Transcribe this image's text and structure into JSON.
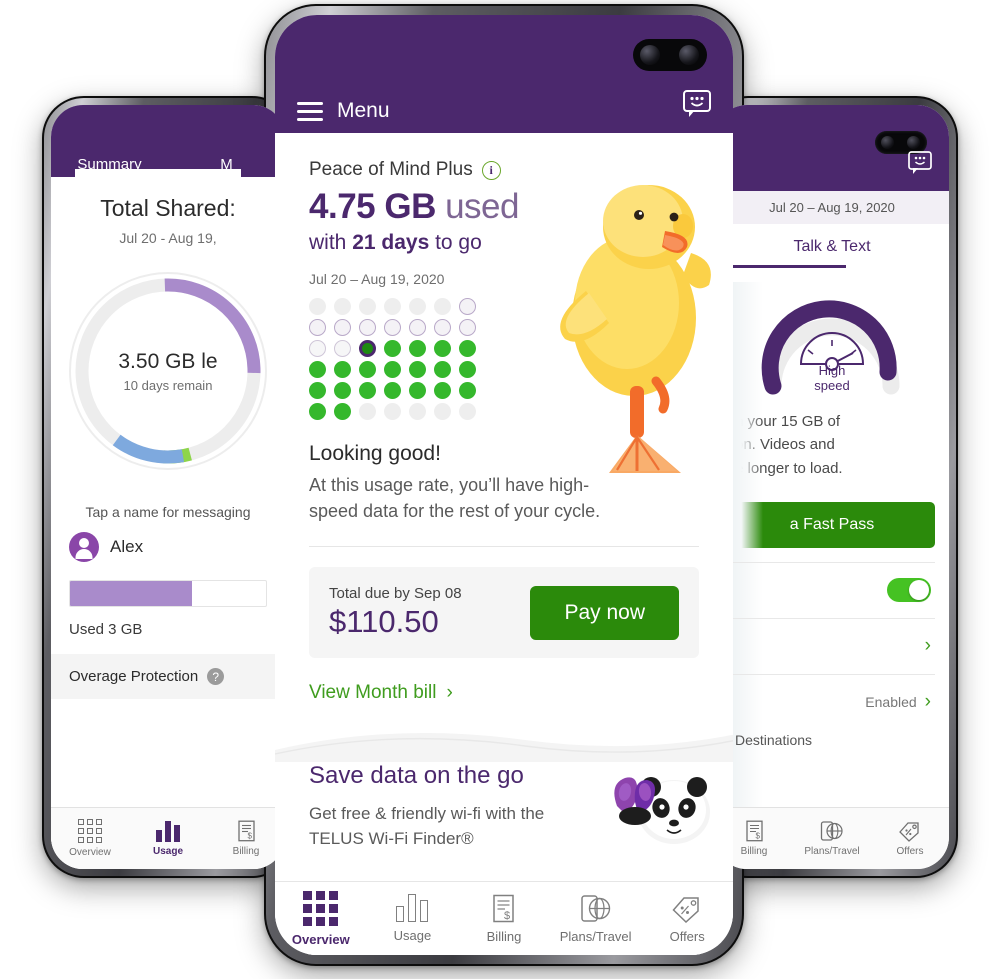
{
  "left_phone": {
    "tabs": [
      {
        "label": "Summary",
        "active": true
      },
      {
        "label": "M",
        "active": false
      }
    ],
    "title": "Total Shared:",
    "date_range": "Jul 20 - Aug 19,",
    "donut": {
      "center_main": "3.50 GB le",
      "center_note": "10 days remain",
      "segments": [
        {
          "name": "used-purple",
          "color": "#A98BCB",
          "percent": 26
        },
        {
          "name": "remaining-track",
          "color": "#ededed",
          "percent": 56
        },
        {
          "name": "green-segment",
          "color": "#8ED54A",
          "percent": 5
        },
        {
          "name": "blue-segment",
          "color": "#7EA9DE",
          "percent": 13
        }
      ]
    },
    "tap_hint": "Tap a name for messaging",
    "person": {
      "name": "Alex",
      "avatar": "person-avatar"
    },
    "usage_bar": {
      "fill_percent": 62,
      "used_label": "Used 3 GB"
    },
    "overage": {
      "label": "Overage Protection",
      "help": "?"
    },
    "tabbar": [
      {
        "label": "Overview",
        "icon": "grid-icon",
        "active": false
      },
      {
        "label": "Usage",
        "icon": "bar-chart-icon",
        "active": true
      },
      {
        "label": "Billing",
        "icon": "receipt-icon",
        "active": false
      }
    ]
  },
  "center_phone": {
    "header": {
      "menu_label": "Menu",
      "menu_icon": "hamburger-icon",
      "chat_icon": "chat-smiley-icon"
    },
    "plan": {
      "name": "Peace of Mind Plus",
      "info_icon": "info-icon"
    },
    "usage": {
      "amount": "4.75 GB",
      "amount_suffix": " used",
      "days_prefix": "with ",
      "days": "21 days",
      "days_suffix": " to go",
      "date_range": "Jul 20 – Aug 19, 2020"
    },
    "status": {
      "headline": "Looking good!",
      "body": "At this usage rate, you’ll have high-speed data for the rest of your cycle."
    },
    "bill": {
      "due_label": "Total due by Sep 08",
      "amount": "$110.50",
      "pay_label": "Pay now",
      "view_label": "View Month bill",
      "view_chevron": "›"
    },
    "promo": {
      "title": "Save data on the go",
      "body": "Get free & friendly wi-fi with the TELUS Wi-Fi Finder®",
      "image": "panda-illustration"
    },
    "hero_image": "duckling-illustration",
    "tabbar": [
      {
        "label": "Overview",
        "icon": "grid-icon",
        "active": true
      },
      {
        "label": "Usage",
        "icon": "bar-chart-icon",
        "active": false
      },
      {
        "label": "Billing",
        "icon": "receipt-icon",
        "active": false
      },
      {
        "label": "Plans/Travel",
        "icon": "phone-globe-icon",
        "active": false
      },
      {
        "label": "Offers",
        "icon": "tags-icon",
        "active": false
      }
    ]
  },
  "right_phone": {
    "chat_icon": "chat-smiley-icon",
    "date_range": "Jul 20 – Aug 19, 2020",
    "tab_label": "Talk & Text",
    "gauge": {
      "label_line1": "High",
      "label_line2": "speed",
      "icon": "speedometer-icon",
      "fill_percent": 88
    },
    "paragraph": "n your 15 GB of\non. Videos and\ne longer to load.",
    "fast_pass_button": "a Fast Pass",
    "rows": [
      {
        "name": "toggle-row",
        "control": "toggle",
        "state": "on"
      },
      {
        "name": "chevron-row",
        "control": "chevron",
        "value": ""
      },
      {
        "name": "enabled-row",
        "control": "chevron",
        "value": "Enabled"
      }
    ],
    "destinations_label": "Destinations",
    "tabbar": [
      {
        "label": "Billing",
        "icon": "receipt-icon",
        "active": false
      },
      {
        "label": "Plans/Travel",
        "icon": "phone-globe-icon",
        "active": false
      },
      {
        "label": "Offers",
        "icon": "tags-icon",
        "active": false
      }
    ]
  },
  "dot_grid": {
    "rows": [
      [
        "empty",
        "empty",
        "empty",
        "empty",
        "empty",
        "empty",
        "ring"
      ],
      [
        "ring",
        "ring",
        "ring",
        "ring",
        "ring",
        "ring",
        "ring"
      ],
      [
        "ringlt",
        "ringlt",
        "cur",
        "green",
        "green",
        "green",
        "green"
      ],
      [
        "green",
        "green",
        "green",
        "green",
        "green",
        "green",
        "green"
      ],
      [
        "green",
        "green",
        "green",
        "green",
        "green",
        "green",
        "green"
      ],
      [
        "green",
        "green",
        "empty",
        "empty",
        "empty",
        "empty",
        "empty"
      ]
    ],
    "legend": {
      "green": "#35B82C",
      "current": "#1e8a12",
      "current_ring": "#4B286D",
      "empty": "#eeeeee"
    }
  },
  "colors": {
    "brand_purple": "#4B286D",
    "brand_green": "#2B8A0B",
    "accent_green": "#35B82C",
    "light_purple": "#A98BCB"
  }
}
